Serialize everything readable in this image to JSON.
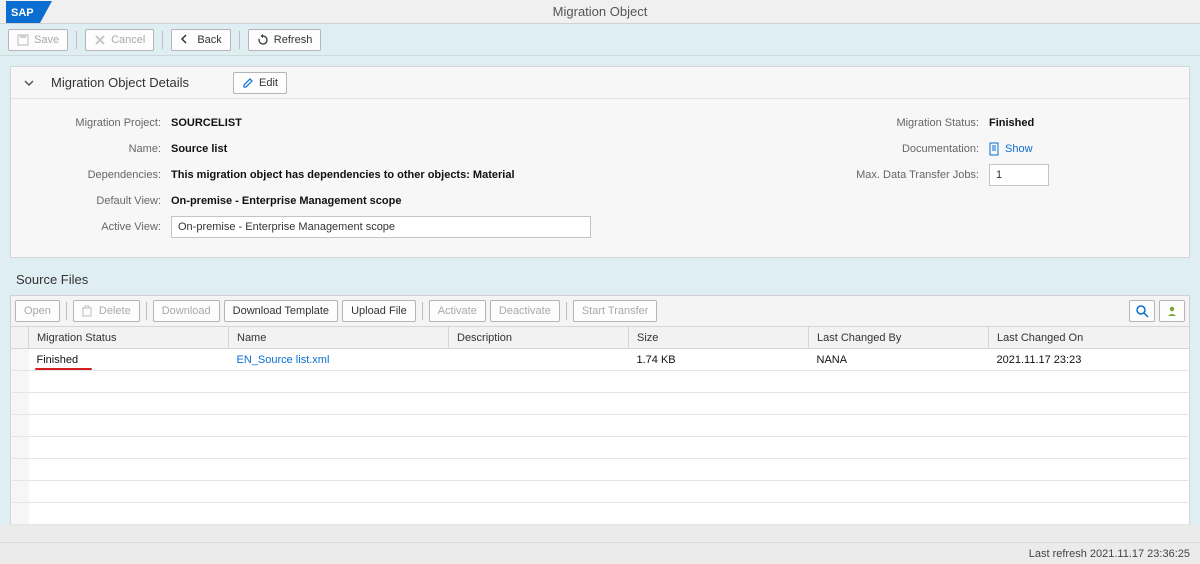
{
  "header": {
    "title": "Migration Object"
  },
  "toolbar": {
    "save": "Save",
    "cancel": "Cancel",
    "back": "Back",
    "refresh": "Refresh"
  },
  "details_panel": {
    "title": "Migration Object Details",
    "edit": "Edit",
    "left": {
      "migration_project_label": "Migration Project:",
      "migration_project": "SOURCELIST",
      "name_label": "Name:",
      "name": "Source list",
      "dependencies_label": "Dependencies:",
      "dependencies": "This migration object has dependencies to other objects: Material",
      "default_view_label": "Default View:",
      "default_view": "On-premise - Enterprise Management scope",
      "active_view_label": "Active View:",
      "active_view": "On-premise - Enterprise Management scope"
    },
    "right": {
      "migration_status_label": "Migration Status:",
      "migration_status": "Finished",
      "documentation_label": "Documentation:",
      "documentation_link": "Show",
      "max_jobs_label": "Max. Data Transfer Jobs:",
      "max_jobs": "1"
    }
  },
  "source_files": {
    "title": "Source Files",
    "buttons": {
      "open": "Open",
      "delete": "Delete",
      "download": "Download",
      "download_template": "Download Template",
      "upload_file": "Upload File",
      "activate": "Activate",
      "deactivate": "Deactivate",
      "start_transfer": "Start Transfer"
    },
    "columns": {
      "migration_status": "Migration Status",
      "name": "Name",
      "description": "Description",
      "size": "Size",
      "last_changed_by": "Last Changed By",
      "last_changed_on": "Last Changed On"
    },
    "rows": [
      {
        "migration_status": "Finished",
        "name": "EN_Source list.xml",
        "description": "",
        "size": "1.74 KB",
        "last_changed_by": "NANA",
        "last_changed_on": "2021.11.17 23:23"
      }
    ]
  },
  "footer": {
    "last_refresh": "Last refresh 2021.11.17 23:36:25"
  }
}
